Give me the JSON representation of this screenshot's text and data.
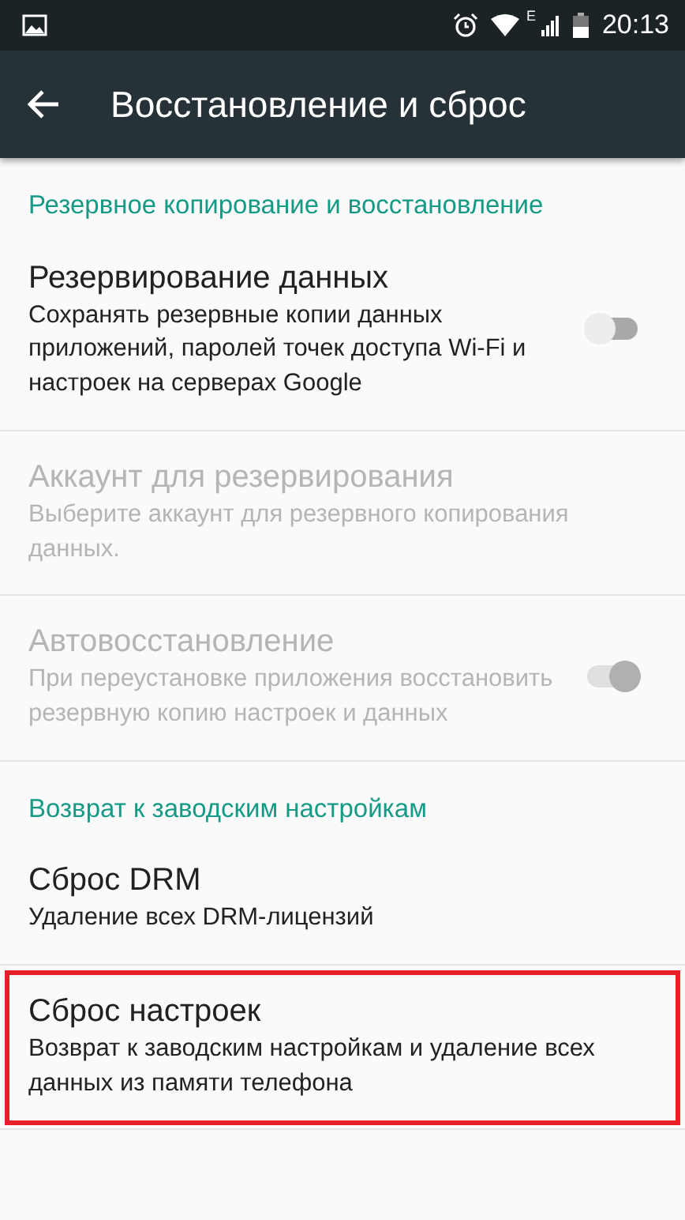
{
  "status_bar": {
    "time": "20:13",
    "network": "E"
  },
  "toolbar": {
    "title": "Восстановление и сброс"
  },
  "list": [
    {
      "kind": "header",
      "title": "Резервное копирование и восстановление"
    },
    {
      "kind": "toggle",
      "title": "Резервирование данных",
      "summary": "Сохранять резервные копии данных приложений, паролей точек доступа Wi-Fi и настроек на серверах Google",
      "checked": false,
      "disabled": false,
      "highlighted": false
    },
    {
      "kind": "item",
      "title": "Аккаунт для резервирования",
      "summary": "Выберите аккаунт для резервного копирования данных.",
      "disabled": true,
      "highlighted": false
    },
    {
      "kind": "toggle",
      "title": "Автовосстановление",
      "summary": "При переустановке приложения восстановить резервную копию настроек и данных",
      "checked": true,
      "disabled": true,
      "highlighted": false
    },
    {
      "kind": "header",
      "title": "Возврат к заводским настройкам"
    },
    {
      "kind": "item",
      "title": "Сброс DRM",
      "summary": "Удаление всех DRM-лицензий",
      "disabled": false,
      "highlighted": false
    },
    {
      "kind": "item",
      "title": "Сброс настроек",
      "summary": "Возврат к заводским настройкам и удаление всех данных из памяти телефона",
      "disabled": false,
      "highlighted": true
    }
  ]
}
